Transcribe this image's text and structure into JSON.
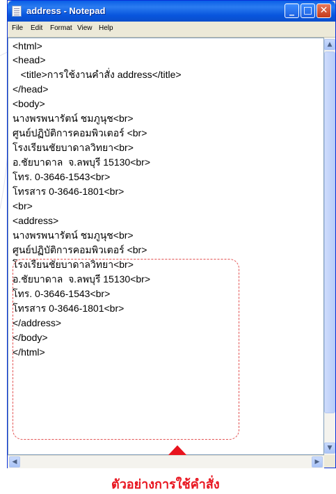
{
  "window": {
    "title": "address - Notepad"
  },
  "menu": [
    "File",
    "Edit",
    "Format",
    "View",
    "Help"
  ],
  "editor": {
    "lines": [
      "<html>",
      "<head>",
      "   <title>การใช้งานคำสั่ง address</title>",
      "</head>",
      "<body>",
      "นางพรพนารัตน์ ชมภูนุช<br>",
      "ศูนย์ปฏิบัติการคอมพิวเตอร์ <br>",
      "โรงเรียนชัยบาดาลวิทยา<br>",
      "อ.ชัยบาดาล  จ.ลพบุรี 15130<br>",
      "โทร. 0-3646-1543<br>",
      "โทรสาร 0-3646-1801<br>",
      "<br>",
      "<address>",
      "นางพรพนารัตน์ ชมภูนุช<br>",
      "ศูนย์ปฏิบัติการคอมพิวเตอร์ <br>",
      "โรงเรียนชัยบาดาลวิทยา<br>",
      "อ.ชัยบาดาล  จ.ลพบุรี 15130<br>",
      "โทร. 0-3646-1543<br>",
      "โทรสาร 0-3646-1801<br>",
      "</address>",
      "</body>",
      "</html>"
    ]
  },
  "caption": "ตัวอย่างการใช้คำสั่ง",
  "colors": {
    "titlebar": "#0a5fe6",
    "annotation": "#e8141e"
  }
}
